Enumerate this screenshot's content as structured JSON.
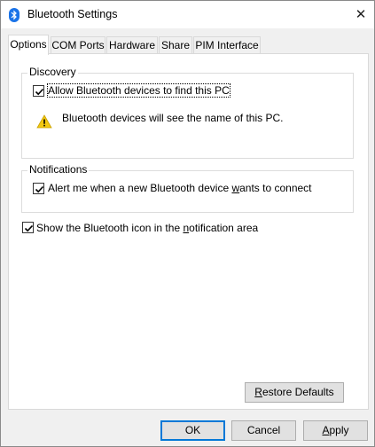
{
  "window": {
    "title": "Bluetooth Settings",
    "close": "✕"
  },
  "tabs": [
    "Options",
    "COM Ports",
    "Hardware",
    "Share",
    "PIM Interface"
  ],
  "discovery": {
    "label": "Discovery",
    "allow_label": "Allow Bluetooth devices to find this PC",
    "allow_checked": true,
    "warning_text": "Bluetooth devices will see the name of this PC."
  },
  "notifications": {
    "label": "Notifications",
    "alert_prefix": "Alert me when a new Bluetooth device ",
    "alert_mnemonic": "w",
    "alert_suffix": "ants to connect",
    "alert_checked": true
  },
  "show_icon": {
    "prefix": "Show the Bluetooth icon in the ",
    "mnemonic": "n",
    "suffix": "otification area",
    "checked": true
  },
  "buttons": {
    "restore_mnemonic": "R",
    "restore_rest": "estore Defaults",
    "ok": "OK",
    "cancel": "Cancel",
    "apply_mnemonic": "A",
    "apply_rest": "pply"
  },
  "colors": {
    "accent": "#0078d7",
    "bluetooth": "#1a73e8",
    "warning": "#f2c811"
  }
}
